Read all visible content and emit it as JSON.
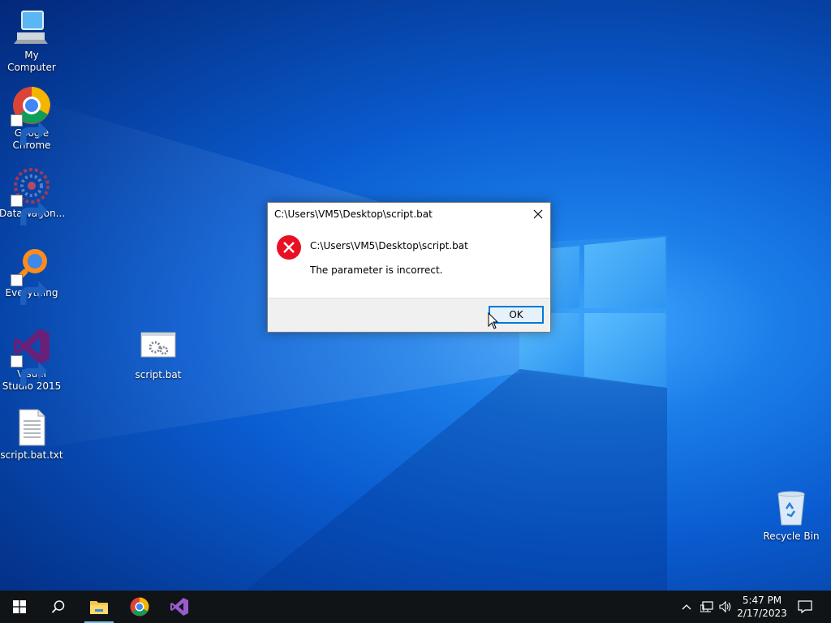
{
  "desktop": {
    "icons": [
      {
        "label": "My Computer"
      },
      {
        "label": "Google Chrome"
      },
      {
        "label": "DataWagon..."
      },
      {
        "label": "Everything"
      },
      {
        "label": "Visual Studio 2015"
      },
      {
        "label": "script.bat.txt"
      },
      {
        "label": "script.bat"
      },
      {
        "label": "Recycle Bin"
      }
    ]
  },
  "dialog": {
    "title": "C:\\Users\\VM5\\Desktop\\script.bat",
    "path": "C:\\Users\\VM5\\Desktop\\script.bat",
    "message": "The parameter is incorrect.",
    "ok_label": "OK",
    "icon": "error-icon",
    "close_icon": "close-icon"
  },
  "taskbar": {
    "buttons": [
      {
        "icon": "windows-start-icon"
      },
      {
        "icon": "search-icon"
      },
      {
        "icon": "file-explorer-icon"
      },
      {
        "icon": "chrome-icon"
      },
      {
        "icon": "visual-studio-icon"
      }
    ],
    "tray": [
      "chevron-up-icon",
      "network-icon",
      "volume-icon",
      "notification-icon"
    ],
    "time": "5:47 PM",
    "date": "2/17/2023"
  },
  "colors": {
    "accent": "#0078d7",
    "error": "#e81123",
    "taskbar": "#101417"
  }
}
